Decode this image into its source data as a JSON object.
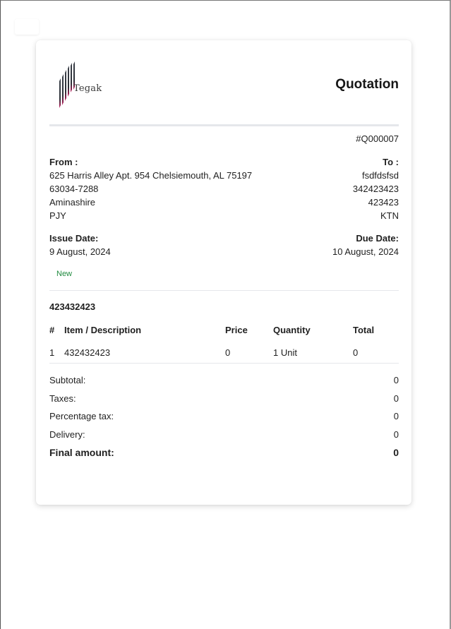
{
  "document": {
    "brand": "Tegak",
    "title": "Quotation",
    "number": "#Q000007",
    "from": {
      "label": "From :",
      "lines": [
        "625 Harris Alley Apt. 954 Chelsiemouth, AL 75197",
        "63034-7288",
        "Aminashire",
        "PJY"
      ]
    },
    "to": {
      "label": "To :",
      "lines": [
        "fsdfdsfsd",
        "342423423",
        "423423",
        "KTN"
      ]
    },
    "issue_date": {
      "label": "Issue Date:",
      "value": "9 August, 2024"
    },
    "due_date": {
      "label": "Due Date:",
      "value": "10 August, 2024"
    },
    "status": "New",
    "reference": "423432423",
    "items_table": {
      "headers": [
        "#",
        "Item / Description",
        "Price",
        "Quantity",
        "Total"
      ],
      "rows": [
        [
          "1",
          "432432423",
          "0",
          "1 Unit",
          "0"
        ]
      ]
    },
    "totals": [
      {
        "label": "Subtotal:",
        "value": "0"
      },
      {
        "label": "Taxes:",
        "value": "0"
      },
      {
        "label": "Percentage tax:",
        "value": "0"
      },
      {
        "label": "Delivery:",
        "value": "0"
      }
    ],
    "final": {
      "label": "Final amount:",
      "value": "0"
    }
  },
  "colors": {
    "status_green": "#1f8a3e",
    "logo_dark": "#2b2f36",
    "logo_accent": "#c2185b"
  },
  "icons": {
    "logo": "tegak-logo-icon"
  }
}
